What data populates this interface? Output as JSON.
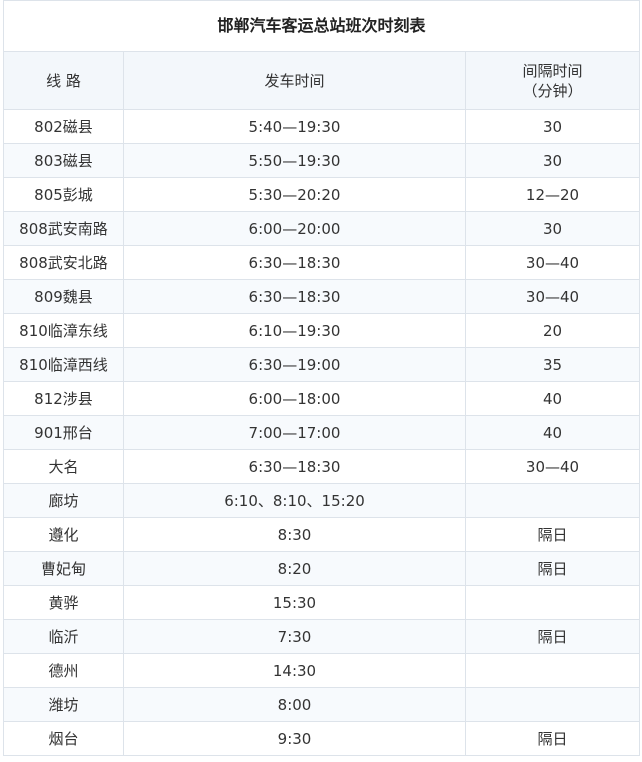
{
  "table": {
    "title": "邯郸汽车客运总站班次时刻表",
    "headers": {
      "route": "线 路",
      "departure": "发车时间",
      "interval": "间隔时间\n（分钟）"
    },
    "rows": [
      {
        "route": "802磁县",
        "departure": "5:40—19:30",
        "interval": "30"
      },
      {
        "route": "803磁县",
        "departure": "5:50—19:30",
        "interval": "30"
      },
      {
        "route": "805彭城",
        "departure": "5:30—20:20",
        "interval": "12—20"
      },
      {
        "route": "808武安南路",
        "departure": "6:00—20:00",
        "interval": "30"
      },
      {
        "route": "808武安北路",
        "departure": "6:30—18:30",
        "interval": "30—40"
      },
      {
        "route": "809魏县",
        "departure": "6:30—18:30",
        "interval": "30—40"
      },
      {
        "route": "810临漳东线",
        "departure": "6:10—19:30",
        "interval": "20"
      },
      {
        "route": "810临漳西线",
        "departure": "6:30—19:00",
        "interval": "35"
      },
      {
        "route": "812涉县",
        "departure": "6:00—18:00",
        "interval": "40"
      },
      {
        "route": "901邢台",
        "departure": "7:00—17:00",
        "interval": "40"
      },
      {
        "route": "大名",
        "departure": "6:30—18:30",
        "interval": "30—40"
      },
      {
        "route": "廊坊",
        "departure": "6:10、8:10、15:20",
        "interval": ""
      },
      {
        "route": "遵化",
        "departure": "8:30",
        "interval": "隔日"
      },
      {
        "route": "曹妃甸",
        "departure": "8:20",
        "interval": "隔日"
      },
      {
        "route": "黄骅",
        "departure": "15:30",
        "interval": ""
      },
      {
        "route": "临沂",
        "departure": "7:30",
        "interval": "隔日"
      },
      {
        "route": "德州",
        "departure": "14:30",
        "interval": ""
      },
      {
        "route": "潍坊",
        "departure": "8:00",
        "interval": ""
      },
      {
        "route": "烟台",
        "departure": "9:30",
        "interval": "隔日"
      }
    ]
  }
}
